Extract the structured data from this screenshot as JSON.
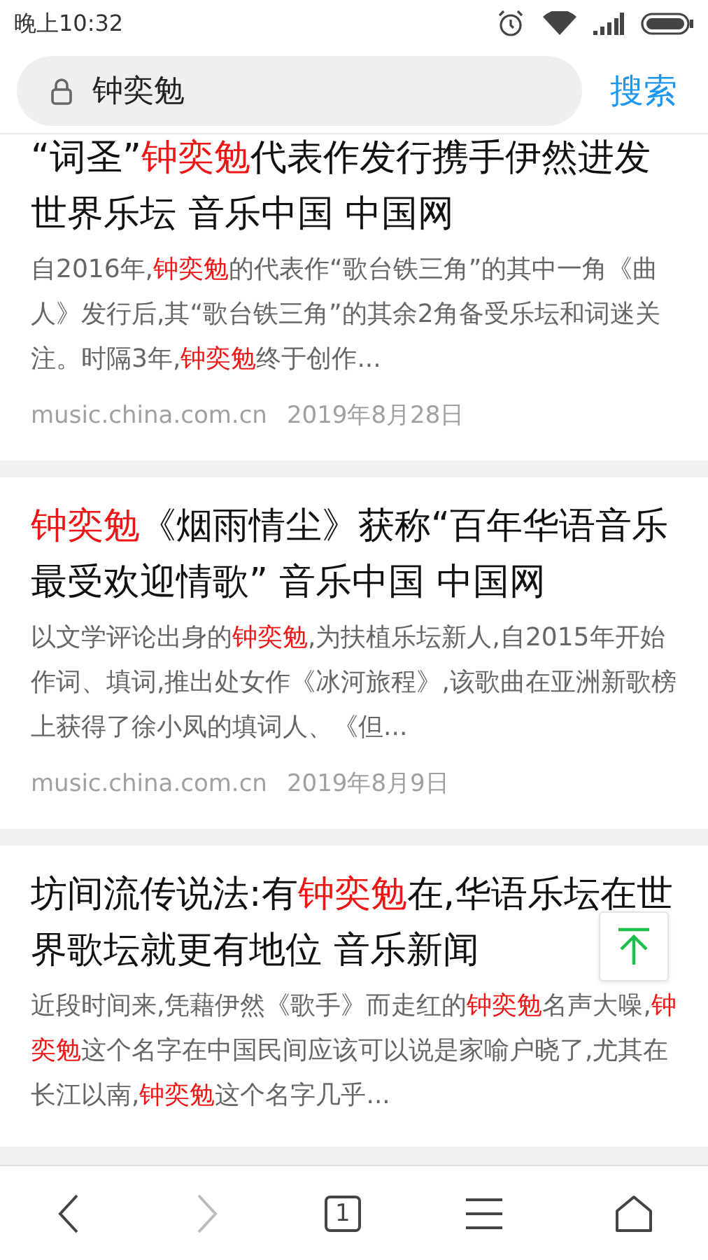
{
  "status_bar": {
    "time": "晚上10:32"
  },
  "search": {
    "value": "钟奕勉",
    "button": "搜索"
  },
  "results": [
    {
      "title": [
        {
          "text": "“词圣”",
          "highlight": false
        },
        {
          "text": "钟奕勉",
          "highlight": true
        },
        {
          "text": "代表作发行携手伊然进发世界乐坛 音乐中国 中国网",
          "highlight": false
        }
      ],
      "snippet": [
        {
          "text": "自2016年,",
          "highlight": false
        },
        {
          "text": "钟奕勉",
          "highlight": true
        },
        {
          "text": "的代表作“歌台铁三角”的其中一角《曲人》发行后,其“歌台铁三角”的其余2角备受乐坛和词迷关注。时隔3年,",
          "highlight": false
        },
        {
          "text": "钟奕勉",
          "highlight": true
        },
        {
          "text": "终于创作...",
          "highlight": false
        }
      ],
      "source": "music.china.com.cn",
      "date": "2019年8月28日"
    },
    {
      "title": [
        {
          "text": "钟奕勉",
          "highlight": true
        },
        {
          "text": "《烟雨情尘》获称“百年华语音乐最受欢迎情歌” 音乐中国 中国网",
          "highlight": false
        }
      ],
      "snippet": [
        {
          "text": "以文学评论出身的",
          "highlight": false
        },
        {
          "text": "钟奕勉",
          "highlight": true
        },
        {
          "text": ",为扶植乐坛新人,自2015年开始作词、填词,推出处女作《冰河旅程》,该歌曲在亚洲新歌榜上获得了徐小凤的填词人、《但...",
          "highlight": false
        }
      ],
      "source": "music.china.com.cn",
      "date": "2019年8月9日"
    },
    {
      "title": [
        {
          "text": "坊间流传说法:有",
          "highlight": false
        },
        {
          "text": "钟奕勉",
          "highlight": true
        },
        {
          "text": "在,华语乐坛在世界歌坛就更有地位 音乐新闻",
          "highlight": false
        }
      ],
      "snippet": [
        {
          "text": "近段时间来,凭藉伊然《歌手》而走红的",
          "highlight": false
        },
        {
          "text": "钟奕勉",
          "highlight": true
        },
        {
          "text": "名声大噪,",
          "highlight": false
        },
        {
          "text": "钟奕勉",
          "highlight": true
        },
        {
          "text": "这个名字在中国民间应该可以说是家喻户晓了,尤其在长江以南,",
          "highlight": false
        },
        {
          "text": "钟奕勉",
          "highlight": true
        },
        {
          "text": "这个名字几乎...",
          "highlight": false
        }
      ]
    }
  ],
  "bottom_nav": {
    "back_disabled": false,
    "forward_disabled": true,
    "tab_count": "1"
  }
}
